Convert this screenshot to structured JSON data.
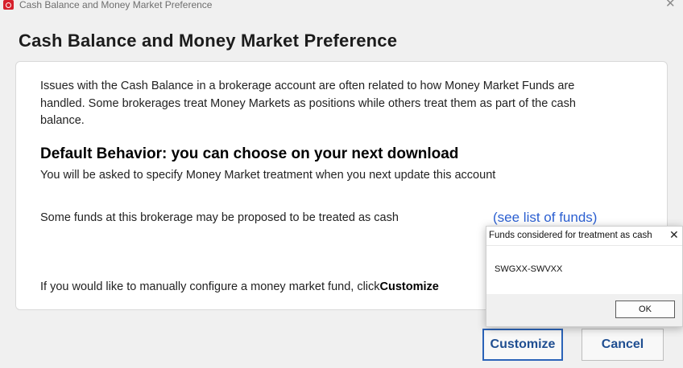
{
  "window": {
    "title": "Cash Balance and Money Market Preference",
    "close_glyph": "✕"
  },
  "dialog": {
    "heading": "Cash Balance and Money Market Preference",
    "intro": "Issues with the Cash Balance in a brokerage account are often related to how Money Market Funds are handled. Some brokerages treat Money Markets as positions while others treat them as part of the cash balance.",
    "default_title": "Default Behavior: you can choose on your next download",
    "default_text": "You will be asked to specify Money Market treatment when you next update this account",
    "funds_text": "Some funds at this brokerage may be proposed to be treated as cash",
    "funds_link": "(see list of funds)",
    "manual_text": "If you would like to manually configure a money market fund, click",
    "manual_bold": "Customize"
  },
  "buttons": {
    "customize": "Customize",
    "cancel": "Cancel"
  },
  "popup": {
    "title": "Funds considered for treatment as cash",
    "close_glyph": "✕",
    "funds": "SWGXX-SWVXX",
    "ok": "OK"
  },
  "colors": {
    "link": "#2b5fd1",
    "button_text": "#1f4e91",
    "app_icon": "#d6202c",
    "focus_border": "#2b63b8"
  },
  "icons": {
    "app": "quicken-logo-icon",
    "close": "close-icon"
  }
}
